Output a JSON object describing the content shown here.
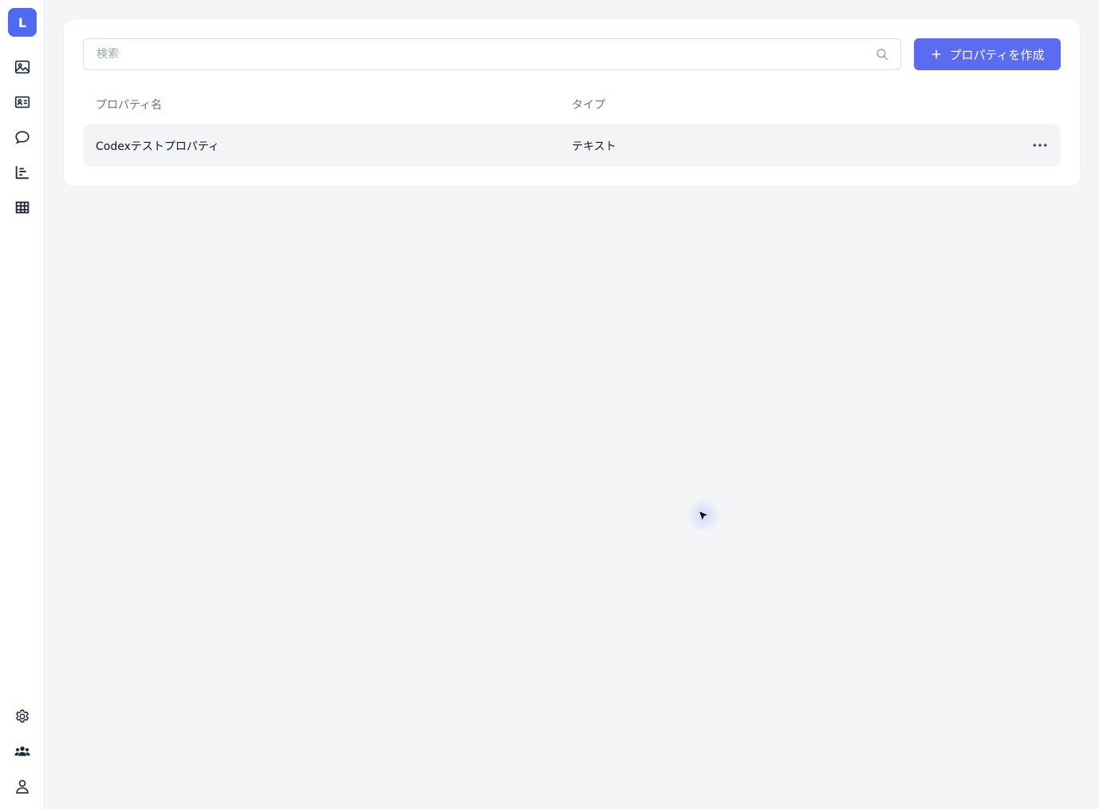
{
  "brand": {
    "logo_letter": "L",
    "accent_color": "#5b6cf0"
  },
  "sidebar": {
    "top_items": [
      {
        "icon": "image-icon"
      },
      {
        "icon": "id-card-icon"
      },
      {
        "icon": "chat-bubble-icon"
      },
      {
        "icon": "bar-chart-icon"
      },
      {
        "icon": "table-grid-icon"
      }
    ],
    "bottom_items": [
      {
        "icon": "gear-icon"
      },
      {
        "icon": "users-group-icon"
      },
      {
        "icon": "user-icon"
      }
    ]
  },
  "search": {
    "placeholder": "検索",
    "value": ""
  },
  "toolbar": {
    "create_label": "プロパティを作成"
  },
  "table": {
    "columns": [
      "プロパティ名",
      "タイプ"
    ],
    "rows": [
      {
        "name": "Codexテストプロパティ",
        "type": "テキスト"
      }
    ]
  }
}
